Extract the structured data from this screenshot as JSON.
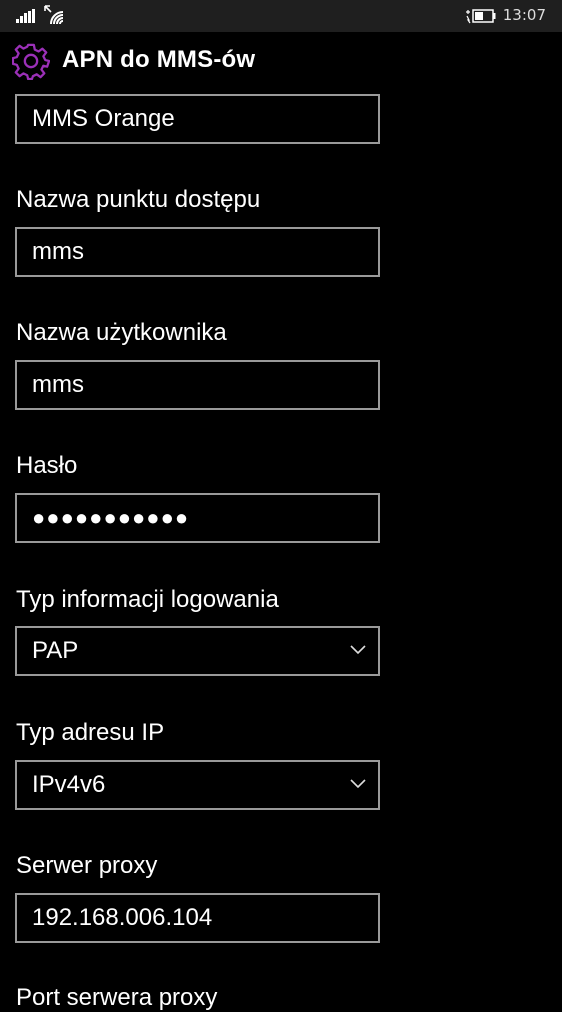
{
  "status_bar": {
    "time": "13:07"
  },
  "header": {
    "title": "APN do MMS-ów",
    "accent_color": "#9b30b8"
  },
  "fields": {
    "profile_name": {
      "value": "MMS Orange"
    },
    "access_point_name": {
      "label": "Nazwa punktu dostępu",
      "value": "mms"
    },
    "username": {
      "label": "Nazwa użytkownika",
      "value": "mms"
    },
    "password": {
      "label": "Hasło",
      "value": "●●●●●●●●●●●"
    },
    "auth_type": {
      "label": "Typ informacji logowania",
      "value": "PAP"
    },
    "ip_type": {
      "label": "Typ adresu IP",
      "value": "IPv4v6"
    },
    "proxy_server": {
      "label": "Serwer proxy",
      "value": "192.168.006.104"
    },
    "proxy_port": {
      "label": "Port serwera proxy"
    }
  }
}
